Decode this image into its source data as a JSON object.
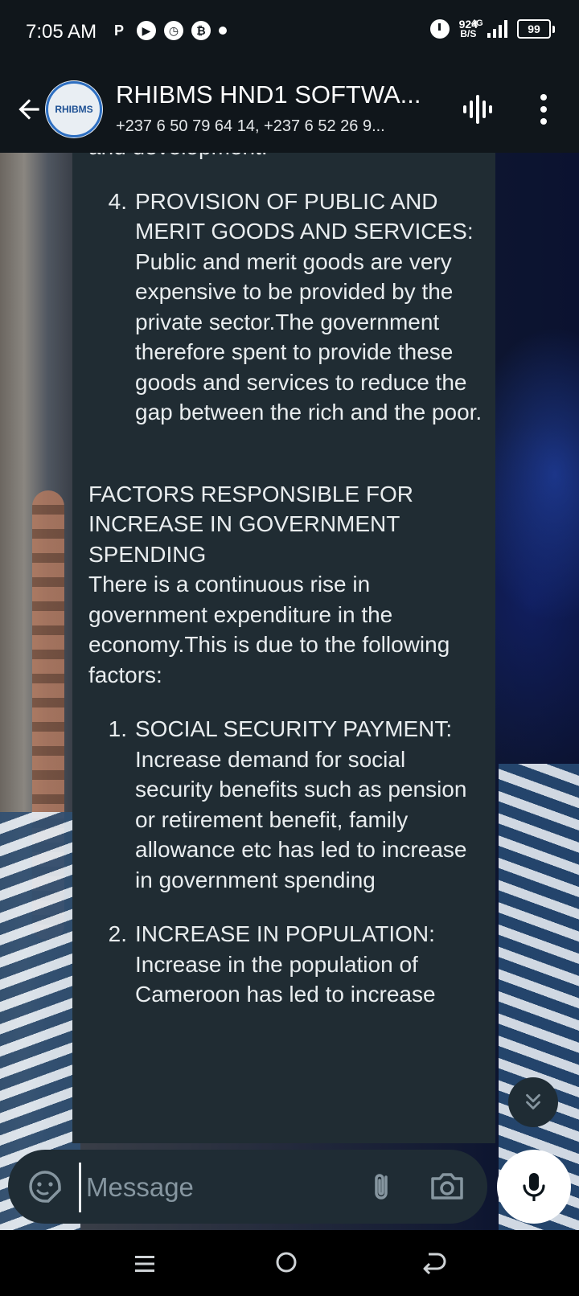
{
  "status_bar": {
    "time": "7:05 AM",
    "left_icons": [
      "p-icon",
      "pinterest-icon",
      "alarm-icon",
      "bitcoin-icon",
      "dot-icon"
    ],
    "net_speed_value": "924",
    "net_speed_unit": "B/S",
    "network_type": "4G",
    "battery_level": "99"
  },
  "app_bar": {
    "title": "RHIBMS HND1 SOFTWA...",
    "subtitle": "+237 6 50 79 64 14, +237 6 52 26 9...",
    "avatar_text": "RHIBMS"
  },
  "message": {
    "top_fragment": "and development.",
    "list_a": [
      {
        "num": "4.",
        "text": "PROVISION OF PUBLIC AND MERIT GOODS AND SERVICES: Public and merit goods are very expensive to be provided by the private sector.The government therefore spent to provide these goods and services to reduce the gap between the rich and the poor."
      }
    ],
    "heading": "FACTORS RESPONSIBLE FOR INCREASE IN GOVERNMENT SPENDING",
    "intro": "There is a continuous rise in government expenditure in the economy.This is due to the following factors:",
    "list_b": [
      {
        "num": "1.",
        "text": "SOCIAL SECURITY PAYMENT: Increase demand for social security benefits such as pension or retirement benefit, family allowance etc has led to increase in government spending"
      },
      {
        "num": "2.",
        "text": "INCREASE IN POPULATION: Increase in the population of Cameroon has led to increase"
      }
    ]
  },
  "composer": {
    "placeholder": "Message"
  },
  "colors": {
    "bar_bg": "#10161b",
    "bubble_bg": "#202c33",
    "text": "#e9edef",
    "placeholder": "#8696a0"
  }
}
